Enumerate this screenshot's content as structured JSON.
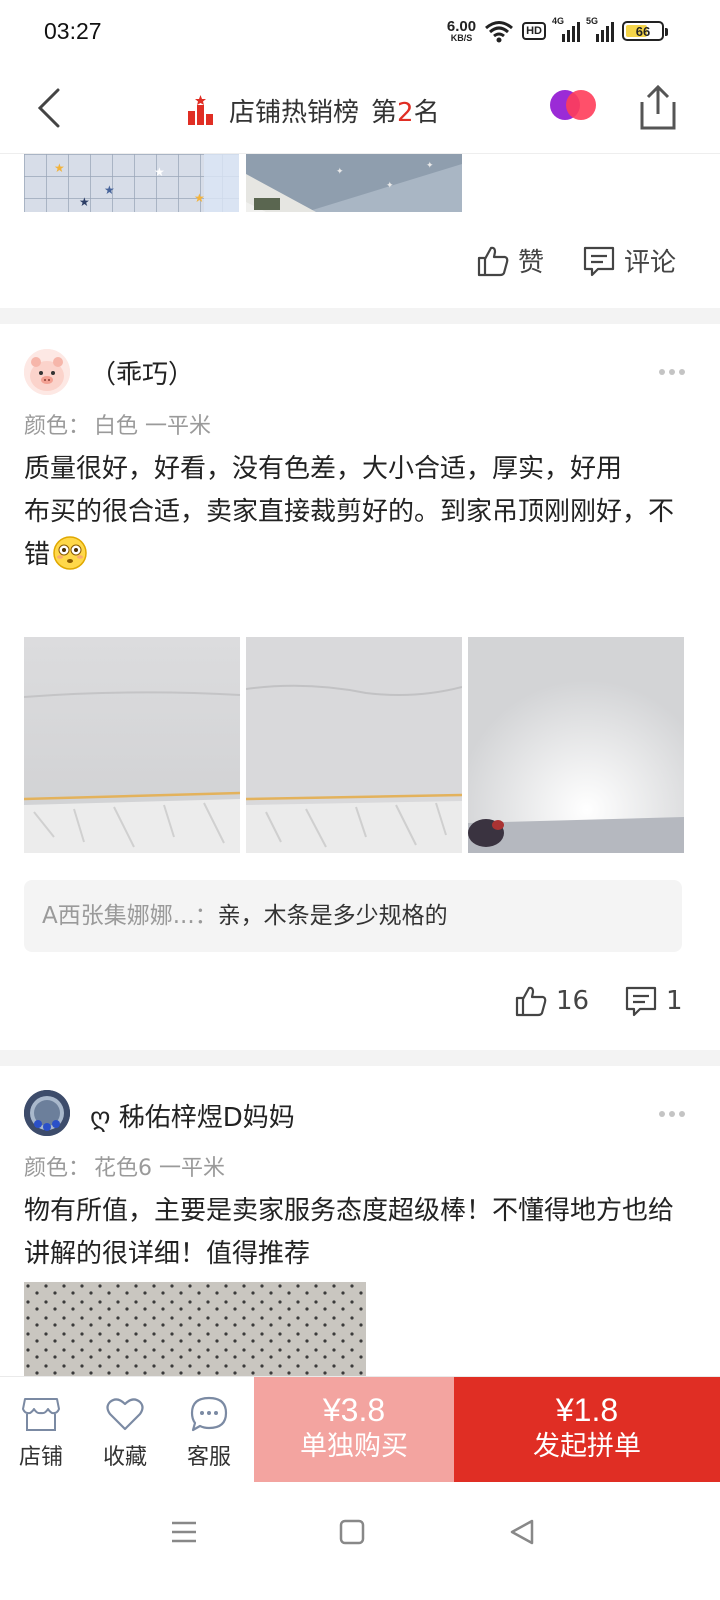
{
  "status_bar": {
    "time": "03:27",
    "net_speed_value": "6.00",
    "net_speed_unit": "KB/S",
    "hd_label": "HD",
    "signal_1_label": "4G",
    "signal_2_label": "5G",
    "battery_level": 66,
    "battery_text": "66"
  },
  "nav": {
    "title": "店铺热销榜",
    "rank_prefix": "第",
    "rank_number": "2",
    "rank_suffix": "名"
  },
  "prev_review": {
    "like_label": "赞",
    "comment_label": "评论"
  },
  "reviews": [
    {
      "username": "（乖巧）",
      "spec_label": "颜色：",
      "spec_value": "白色 一平米",
      "text_line1": "质量很好，好看，没有色差，大小合适，厚实，好用",
      "text_line2": "布买的很合适，卖家直接裁剪好的。到家吊顶刚刚好，不错",
      "reply_author": "A西张集娜娜...：",
      "reply_text": "亲，木条是多少规格的",
      "likes": "16",
      "comments": "1"
    },
    {
      "username": "ღ 秭佑梓煜D妈妈",
      "spec_label": "颜色：",
      "spec_value": "花色6 一平米",
      "text_line1": "物有所值，主要是卖家服务态度超级棒！不懂得地方也给讲解的很详细！值得推荐"
    }
  ],
  "bottom_bar": {
    "tabs": [
      {
        "label": "店铺",
        "icon": "store-icon"
      },
      {
        "label": "收藏",
        "icon": "heart-icon"
      },
      {
        "label": "客服",
        "icon": "chat-icon"
      }
    ],
    "single_price": "¥3.8",
    "single_label": "单独购买",
    "group_price": "¥1.8",
    "group_label": "发起拼单"
  },
  "colors": {
    "accent_red": "#e02e24",
    "single_buy_pink": "#f3a4a0",
    "muted_gray": "#9a9a9a"
  }
}
